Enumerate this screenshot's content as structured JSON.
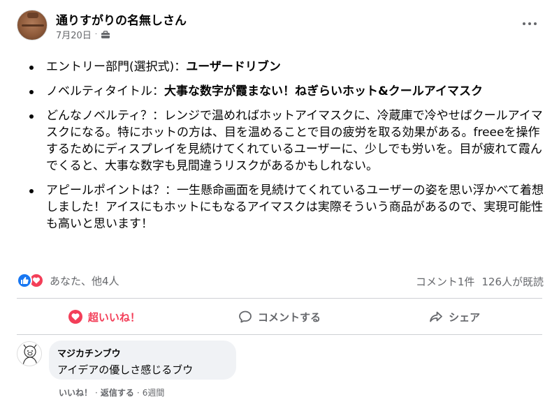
{
  "post": {
    "author": "通りすがりの名無しさん",
    "date": "7月20日",
    "separator": "·",
    "audience_icon": "briefcase-icon",
    "items": [
      {
        "label": "エントリー部門(選択式)：",
        "value": "ユーザードリブン"
      },
      {
        "label": "ノベルティタイトル：",
        "value": "大事な数字が霞まない！ねぎらいホット&クールアイマスク"
      },
      {
        "label": "",
        "value": "",
        "text": "どんなノベルティ？：レンジで温めればホットアイマスクに、冷蔵庫で冷やせばクールアイマスクになる。特にホットの方は、目を温めることで目の疲労を取る効果がある。freeeを操作するためにディスプレイを見続けてくれているユーザーに、少しでも労いを。目が疲れて霞んでくると、大事な数字も見間違うリスクがあるかもしれない。"
      },
      {
        "label": "",
        "value": "",
        "text": "アピールポイントは？：一生懸命画面を見続けてくれているユーザーの姿を思い浮かべて着想しました！アイスにもホットにもなるアイマスクは実際そういう商品があるので、実現可能性も高いと思います！"
      }
    ]
  },
  "reactions": {
    "names": "あなた、他4人",
    "comments": "コメント1件",
    "views": "126人が既読",
    "colors": {
      "like": "#1877f2",
      "love": "#f33e58"
    }
  },
  "actions": {
    "react": "超いいね！",
    "comment": "コメントする",
    "share": "シェア"
  },
  "comment": {
    "author": "マジカチンブウ",
    "text": "アイデアの優しさ感じるブウ",
    "like": "いいね！",
    "reply": "返信する",
    "time": "6週間",
    "separator": "·"
  }
}
